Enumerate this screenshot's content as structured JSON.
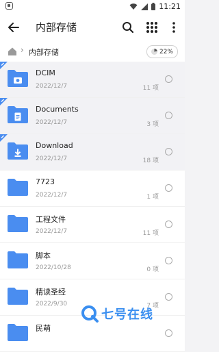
{
  "status_bar": {
    "time": "11:21",
    "icons": [
      "app-notification-icon",
      "wifi-icon",
      "signal-icon",
      "battery-icon"
    ]
  },
  "app_bar": {
    "title": "内部存储",
    "icons": [
      "back-arrow-icon",
      "search-icon",
      "grid-view-icon",
      "more-vert-icon"
    ]
  },
  "breadcrumb": {
    "current": "内部存储",
    "storage_usage": "22%",
    "storage_fraction": 0.22
  },
  "colors": {
    "folder": "#4a8df0",
    "pin_badge": "#4a8df0",
    "watermark": "#3b8ff0"
  },
  "folders": [
    {
      "name": "DCIM",
      "date": "2022/12/7",
      "count": "11 项",
      "pinned": true,
      "glyph": "camera"
    },
    {
      "name": "Documents",
      "date": "2022/12/7",
      "count": "3 项",
      "pinned": true,
      "glyph": "document"
    },
    {
      "name": "Download",
      "date": "2022/12/7",
      "count": "18 项",
      "pinned": true,
      "glyph": "download"
    },
    {
      "name": "7723",
      "date": "2022/12/7",
      "count": "1 项",
      "pinned": false,
      "glyph": ""
    },
    {
      "name": "工程文件",
      "date": "2022/12/7",
      "count": "11 项",
      "pinned": false,
      "glyph": ""
    },
    {
      "name": "脚本",
      "date": "2022/10/28",
      "count": "0 项",
      "pinned": false,
      "glyph": ""
    },
    {
      "name": "精读圣经",
      "date": "2022/9/30",
      "count": "7 项",
      "pinned": false,
      "glyph": ""
    },
    {
      "name": "民萌",
      "date": "",
      "count": "",
      "pinned": false,
      "glyph": ""
    }
  ],
  "watermark": {
    "text": "七号在线"
  }
}
